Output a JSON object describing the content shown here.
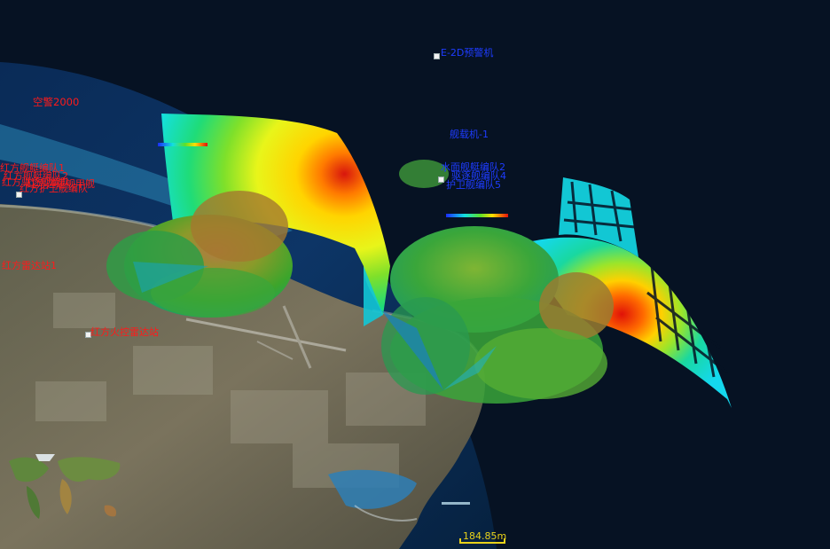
{
  "scene": {
    "title_labels": [
      {
        "id": "awacs",
        "text": "空警2000",
        "color": "red"
      },
      {
        "id": "e2d",
        "text": "E-2D预警机",
        "color": "blue"
      },
      {
        "id": "carrier_aircraft",
        "text": "舰载机-1",
        "color": "blue"
      },
      {
        "id": "ship_group_1",
        "text": "水面舰艇编队2",
        "color": "blue"
      },
      {
        "id": "ship_group_2",
        "text": "驱逐舰编队4",
        "color": "blue"
      },
      {
        "id": "ship_group_3",
        "text": "护卫舰编队5",
        "color": "blue"
      },
      {
        "id": "red_cluster_1",
        "text": "红方舰艇编队1",
        "color": "red"
      },
      {
        "id": "red_cluster_2",
        "text": "红方舰艇编队2",
        "color": "red"
      },
      {
        "id": "red_cluster_3",
        "text": "红方驱逐舰编队",
        "color": "red"
      },
      {
        "id": "red_cluster_4",
        "text": "红方护卫舰编队",
        "color": "red"
      },
      {
        "id": "red_cluster_5",
        "text": "红方巡逻舰甲舰",
        "color": "red"
      },
      {
        "id": "radar_1",
        "text": "红方雷达站1",
        "color": "red"
      },
      {
        "id": "radar_2",
        "text": "红方火控雷达站",
        "color": "red"
      }
    ],
    "scale_bar": {
      "text": "184.85m"
    }
  },
  "colors": {
    "space": "#05101c",
    "ocean_deep": "#0b2a55",
    "ocean_shallow": "#2f8fbf",
    "land": "#6f6a55",
    "label_red": "#ff1a1a",
    "label_blue": "#1e3cff",
    "scale": "#e8d21a"
  }
}
